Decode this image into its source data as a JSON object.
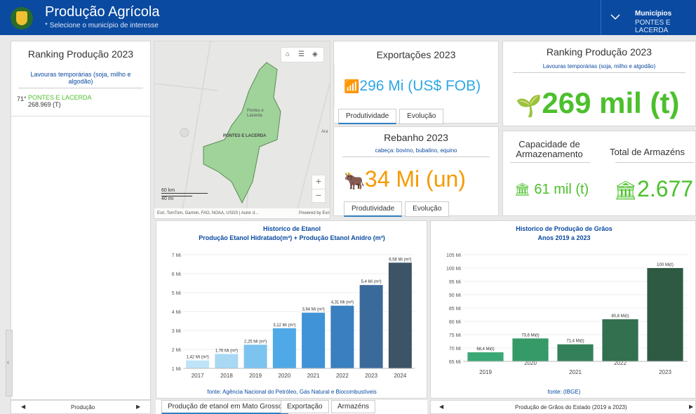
{
  "header": {
    "title": "Produção Agrícola",
    "subtitle": "* Selecione o município de interesse",
    "municipio_label": "Municípios",
    "municipio_value": "PONTES E LACERDA"
  },
  "left_panel": {
    "title": "Ranking Produção 2023",
    "subtitle": "Lavouras temporárias (soja, milho e algodão)",
    "rank": "71°",
    "name": "PONTES E LACERDA",
    "value": "268.969 (T)",
    "footer": "Produção"
  },
  "map": {
    "label_town": "Pontes e\nLacerda",
    "label_town_line1": "Pontes e",
    "label_town_line2": "Lacerda",
    "label_region": "PONTES E LACERDA",
    "label_ara": "Ara",
    "scale_km": "60 km",
    "scale_mi": "40 mi",
    "attribution": "Esri, TomTom, Garmin, FAO, NOAA, USGS | Autor d...",
    "powered": "Powered by Esri"
  },
  "exports": {
    "title": "Exportações 2023",
    "value": "296 Mi (US$ FOB)",
    "tab1": "Produtividade",
    "tab2": "Evolução"
  },
  "herd": {
    "title": "Rebanho 2023",
    "subtitle": "cabeça: bovino, bubalino,  equino",
    "value": "34 Mi (un)",
    "tab1": "Produtividade",
    "tab2": "Evolução"
  },
  "ranking_right": {
    "title": "Ranking Produção 2023",
    "subtitle": "Lavouras temporárias (soja, milho e algodão)",
    "value": "269 mil (t)"
  },
  "storage": {
    "cap_title_1": "Capacidade de",
    "cap_title_2": "Armazenamento",
    "cap_value": "61 mil (t)",
    "total_title": "Total de Armazéns",
    "total_value": "2.677"
  },
  "ethanol_tabs": {
    "tab1": "Produção de etanol em Mato Grosso",
    "tab2": "Exportação",
    "tab3": "Armazéns"
  },
  "grains_footer": "Produção de Grãos do Estado (2019 a 2023)",
  "chart_data": [
    {
      "type": "bar",
      "title": "Historico de Etanol",
      "subtitle": "Produção Etanol Hidratado(m³) + Produção Etanol Anidro (m³)",
      "categories": [
        "2017",
        "2018",
        "2019",
        "2020",
        "2021",
        "2022",
        "2023",
        "2024"
      ],
      "values": [
        1.42,
        1.76,
        2.25,
        3.12,
        3.94,
        4.31,
        5.4,
        6.58
      ],
      "data_labels": [
        "1,42 Mi (m³)",
        "1,76 Mi (m³)",
        "2,25 Mi (m³)",
        "3,12 Mi (m³)",
        "3,94 Mi (m³)",
        "4,31 Mi (m³)",
        "5,4 Mi (m³)",
        "6,58 Mi (m³)"
      ],
      "yticks": [
        "1 Mi",
        "2 Mi",
        "3 Mi",
        "4 Mi",
        "5 Mi",
        "6 Mi",
        "7 Mi"
      ],
      "ylim": [
        1,
        7
      ],
      "colors": [
        "#bfe3f7",
        "#a8d8f4",
        "#7cc3ef",
        "#4fa9e6",
        "#3f93d6",
        "#3a7fbf",
        "#3a6a9a",
        "#3d5366"
      ],
      "source": "fonte: Agência Nacional do Petróleo, Gás Natural e Biocombustíveis"
    },
    {
      "type": "bar",
      "title": "Historico de Produção de Grãos",
      "subtitle": "Anos 2019 a 2023",
      "categories": [
        "2019",
        "2020",
        "2021",
        "2022",
        "2023"
      ],
      "values": [
        68.4,
        73.6,
        71.4,
        80.8,
        100
      ],
      "data_labels": [
        "68,4 Mi(t)",
        "73,6 Mi(t)",
        "71,4 Mi(t)",
        "80,8 Mi(t)",
        "100 Mi(t)"
      ],
      "yticks": [
        "65 Mi",
        "70 Mi",
        "75 Mi",
        "80 Mi",
        "85 Mi",
        "90 Mi",
        "95 Mi",
        "100 Mi",
        "105 Mi"
      ],
      "ylim": [
        65,
        105
      ],
      "colors": [
        "#3aa874",
        "#359968",
        "#34805a",
        "#32704f",
        "#2e5a44"
      ],
      "source": "fonte: (IBGE)"
    }
  ]
}
